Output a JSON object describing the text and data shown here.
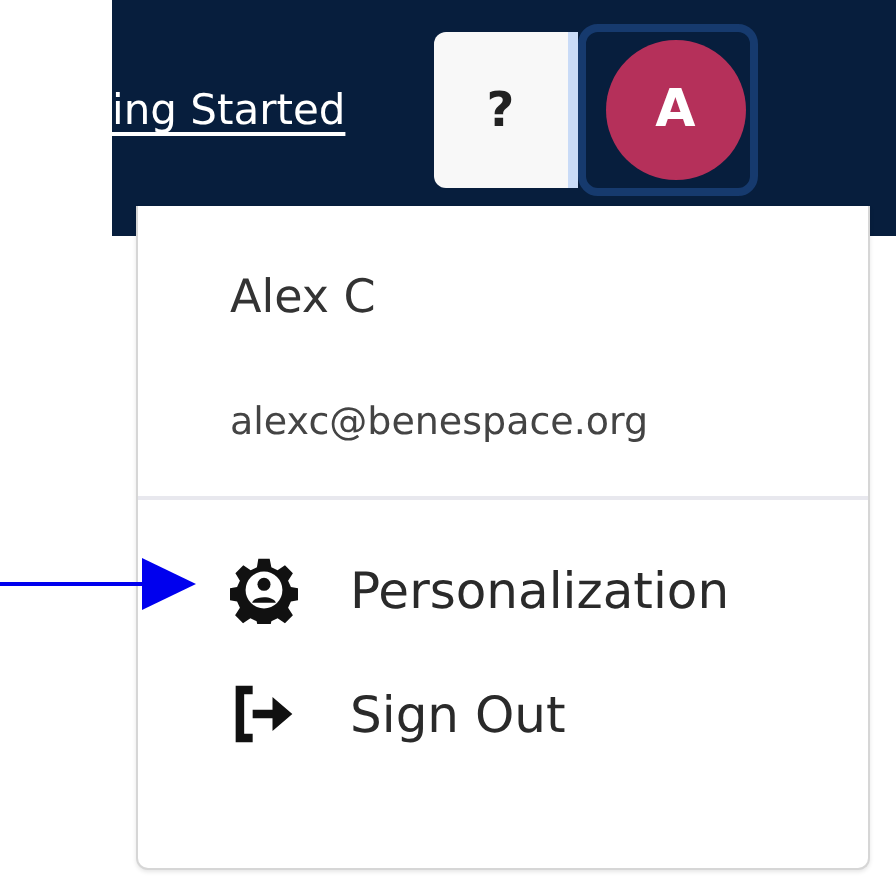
{
  "header": {
    "link": "ing Started",
    "help_button": "?",
    "avatar": "A"
  },
  "user_menu": {
    "name": "Alex C",
    "email": "alexc@benespace.org",
    "items": [
      {
        "kind": "personalization",
        "label": "Personalization"
      },
      {
        "kind": "sign-out",
        "label": "Sign Out"
      }
    ]
  }
}
